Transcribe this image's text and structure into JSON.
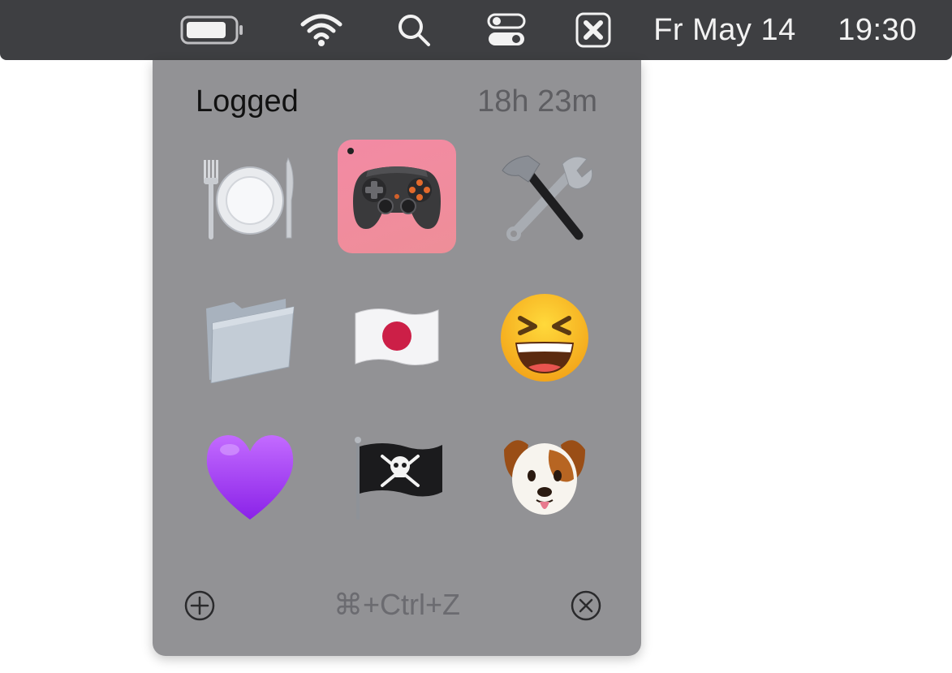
{
  "menubar": {
    "date": "Fr May 14",
    "time": "19:30",
    "icons": [
      "battery-icon",
      "wifi-icon",
      "search-icon",
      "control-center-icon",
      "app-status-icon"
    ]
  },
  "popover": {
    "title": "Logged",
    "duration": "18h 23m",
    "grid": [
      {
        "emoji": "plate-with-cutlery",
        "selected": false
      },
      {
        "emoji": "video-game-controller",
        "selected": true
      },
      {
        "emoji": "hammer-and-wrench",
        "selected": false
      },
      {
        "emoji": "file-folder",
        "selected": false
      },
      {
        "emoji": "japan-flag",
        "selected": false
      },
      {
        "emoji": "grinning-squinting-face",
        "selected": false
      },
      {
        "emoji": "purple-heart",
        "selected": false
      },
      {
        "emoji": "pirate-flag",
        "selected": false
      },
      {
        "emoji": "dog-face",
        "selected": false
      }
    ],
    "shortcut": "⌘+Ctrl+Z",
    "colors": {
      "background": "#929295",
      "selected": "#f08a9f",
      "menubar": "#3e3f42"
    }
  }
}
